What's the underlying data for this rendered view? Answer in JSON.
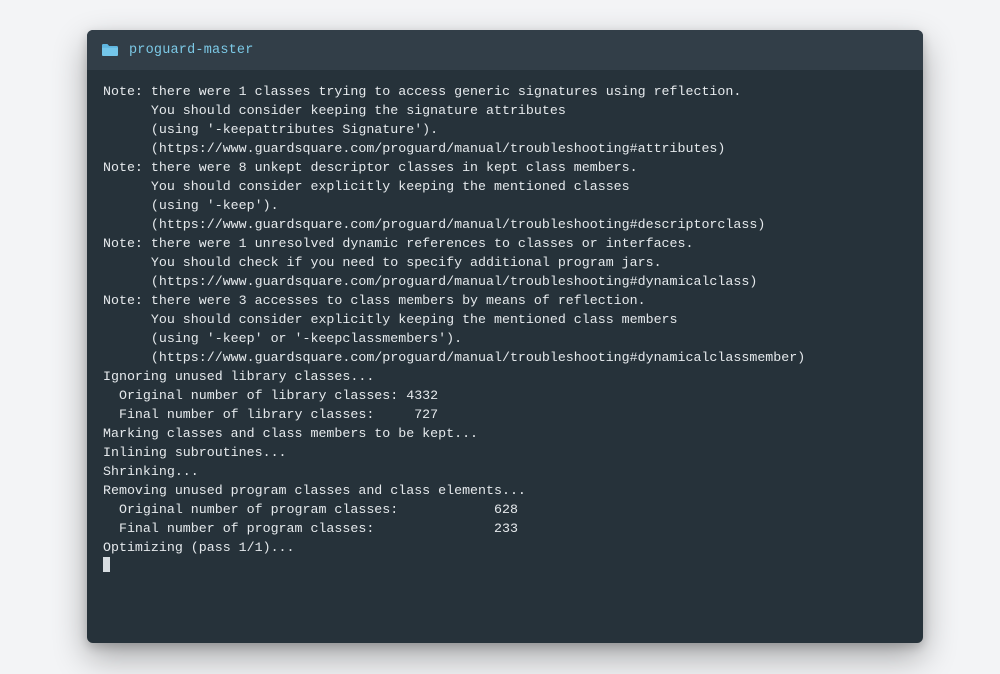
{
  "window": {
    "title": "proguard-master",
    "icon": "folder-icon"
  },
  "terminal": {
    "lines": [
      "Note: there were 1 classes trying to access generic signatures using reflection.",
      "      You should consider keeping the signature attributes",
      "      (using '-keepattributes Signature').",
      "      (https://www.guardsquare.com/proguard/manual/troubleshooting#attributes)",
      "Note: there were 8 unkept descriptor classes in kept class members.",
      "      You should consider explicitly keeping the mentioned classes",
      "      (using '-keep').",
      "      (https://www.guardsquare.com/proguard/manual/troubleshooting#descriptorclass)",
      "Note: there were 1 unresolved dynamic references to classes or interfaces.",
      "      You should check if you need to specify additional program jars.",
      "      (https://www.guardsquare.com/proguard/manual/troubleshooting#dynamicalclass)",
      "Note: there were 3 accesses to class members by means of reflection.",
      "      You should consider explicitly keeping the mentioned class members",
      "      (using '-keep' or '-keepclassmembers').",
      "      (https://www.guardsquare.com/proguard/manual/troubleshooting#dynamicalclassmember)",
      "Ignoring unused library classes...",
      "  Original number of library classes: 4332",
      "  Final number of library classes:     727",
      "Marking classes and class members to be kept...",
      "Inlining subroutines...",
      "Shrinking...",
      "Removing unused program classes and class elements...",
      "  Original number of program classes:            628",
      "  Final number of program classes:               233",
      "Optimizing (pass 1/1)..."
    ]
  },
  "colors": {
    "page_bg": "#f3f4f6",
    "window_bg": "#26323a",
    "titlebar_bg": "#323e48",
    "title_text": "#7cc9e6",
    "terminal_text": "#e5e9ec",
    "folder_icon": "#5fb6e0"
  }
}
